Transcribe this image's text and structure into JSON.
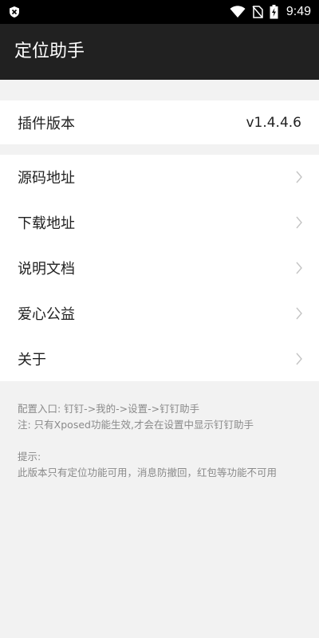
{
  "status_bar": {
    "time": "9:49",
    "icons": [
      "notification-shield-icon",
      "wifi-icon",
      "no-sim-icon",
      "battery-charging-icon"
    ]
  },
  "app_bar": {
    "title": "定位助手"
  },
  "version_row": {
    "label": "插件版本",
    "value": "v1.4.4.6"
  },
  "menu": {
    "items": [
      {
        "label": "源码地址"
      },
      {
        "label": "下载地址"
      },
      {
        "label": "说明文档"
      },
      {
        "label": "爱心公益"
      },
      {
        "label": "关于"
      }
    ]
  },
  "notes": {
    "entry": "配置入口: 钉钉->我的->设置->钉钉助手",
    "note": "注: 只有Xposed功能生效,才会在设置中显示钉钉助手",
    "tip_title": "提示:",
    "tip_text": "此版本只有定位功能可用，消息防撤回，红包等功能不可用"
  },
  "colors": {
    "status_bar": "#000000",
    "app_bar": "#212121",
    "background": "#f2f2f2",
    "card": "#ffffff",
    "note_text": "#8a8a8a"
  }
}
